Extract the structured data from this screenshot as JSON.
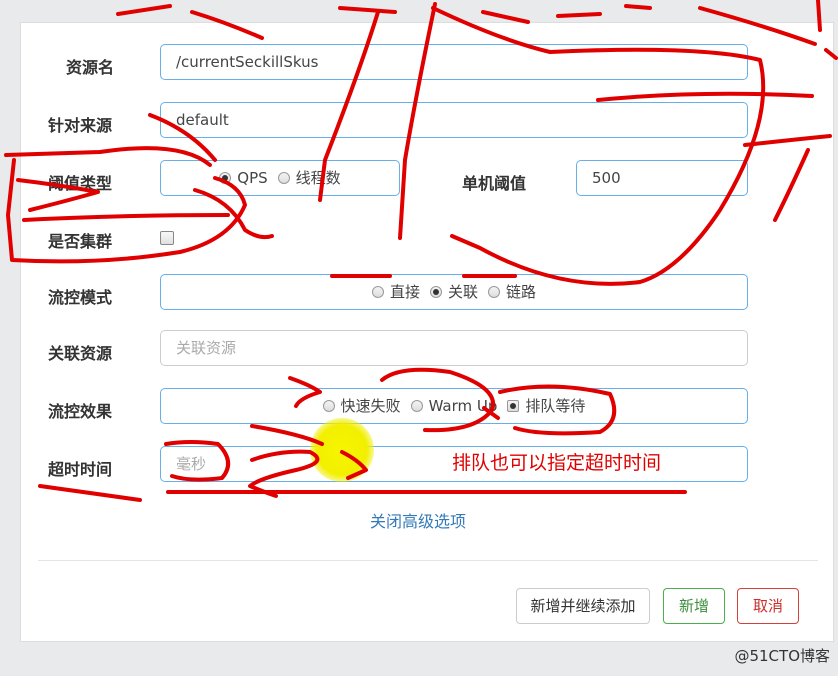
{
  "form": {
    "resource": {
      "label": "资源名",
      "value": "/currentSeckillSkus"
    },
    "source": {
      "label": "针对来源",
      "value": "default"
    },
    "threshold_type": {
      "label": "阈值类型",
      "options": [
        "QPS",
        "线程数"
      ],
      "selected": "QPS"
    },
    "single_threshold": {
      "label": "单机阈值",
      "value": "500"
    },
    "cluster": {
      "label": "是否集群",
      "checked": false
    },
    "flow_mode": {
      "label": "流控模式",
      "options": [
        "直接",
        "关联",
        "链路"
      ],
      "selected": "关联"
    },
    "related_resource": {
      "label": "关联资源",
      "placeholder": "关联资源"
    },
    "flow_effect": {
      "label": "流控效果",
      "options": [
        "快速失败",
        "Warm Up",
        "排队等待"
      ],
      "selected": "排队等待"
    },
    "timeout": {
      "label": "超时时间",
      "placeholder": "毫秒"
    },
    "advanced_link": "关闭高级选项"
  },
  "footer": {
    "add_continue": "新增并继续添加",
    "add": "新增",
    "cancel": "取消"
  },
  "annotation": "排队也可以指定超时时间",
  "watermark": "@51CTO博客",
  "colors": {
    "annotation": "#e00000",
    "link": "#337ab7",
    "add_button": "#3c8d3c",
    "cancel_button": "#c9302c",
    "input_border": "#66afe9"
  }
}
